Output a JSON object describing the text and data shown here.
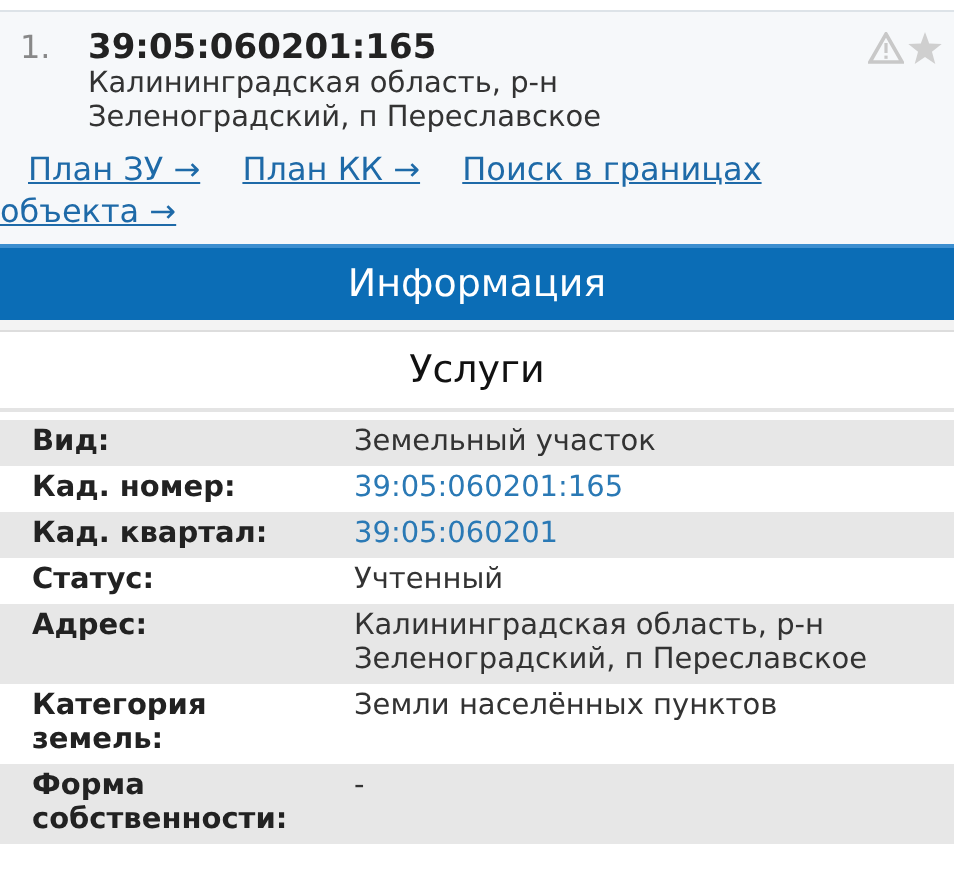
{
  "result": {
    "index": "1.",
    "cadastral_number": "39:05:060201:165",
    "address": "Калининградская область, р-н Зеленоградский, п Переславское",
    "links": [
      "План ЗУ →",
      "План КК →",
      "Поиск в границах объекта →"
    ]
  },
  "info_header": "Информация",
  "services_header": "Услуги",
  "rows": [
    {
      "label": "Вид:",
      "value": "Земельный участок",
      "kind": "text"
    },
    {
      "label": "Кад. номер:",
      "value": "39:05:060201:165",
      "kind": "link"
    },
    {
      "label": "Кад. квартал:",
      "value": "39:05:060201",
      "kind": "link"
    },
    {
      "label": "Статус:",
      "value": "Учтенный",
      "kind": "text"
    },
    {
      "label": "Адрес:",
      "value": "Калининградская область, р-н Зеленоградский, п Переславское",
      "kind": "text"
    },
    {
      "label": "Категория земель:",
      "value": "Земли населённых пунктов",
      "kind": "text"
    },
    {
      "label": "Форма собственности:",
      "value": "-",
      "kind": "text"
    }
  ]
}
